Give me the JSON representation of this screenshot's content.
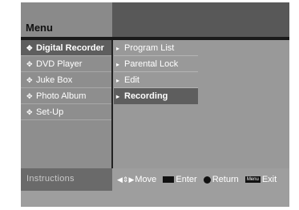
{
  "header": {
    "title": "Menu"
  },
  "sidebar": {
    "items": [
      {
        "label": "Digital Recorder",
        "bullet": "✥",
        "active": true
      },
      {
        "label": "DVD Player",
        "bullet": "✥",
        "active": false
      },
      {
        "label": "Juke Box",
        "bullet": "✥",
        "active": false
      },
      {
        "label": "Photo Album",
        "bullet": "✥",
        "active": false
      },
      {
        "label": "Set-Up",
        "bullet": "✥",
        "active": false
      }
    ]
  },
  "submenu": {
    "items": [
      {
        "label": "Program List",
        "arrow": "▸"
      },
      {
        "label": "Parental Lock",
        "arrow": "▸"
      },
      {
        "label": "Edit",
        "arrow": "▸"
      },
      {
        "label": "Recording",
        "arrow": "▸",
        "selected": true
      }
    ]
  },
  "footer": {
    "instructions_label": "Instructions",
    "move_keys": "◀⇕▶",
    "move_label": "Move",
    "enter_label": "Enter",
    "return_label": "Return",
    "menu_key": "Menu",
    "exit_label": "Exit"
  },
  "colors": {
    "active_bg": "#5e5e5e",
    "panel_bg": "#999999"
  }
}
